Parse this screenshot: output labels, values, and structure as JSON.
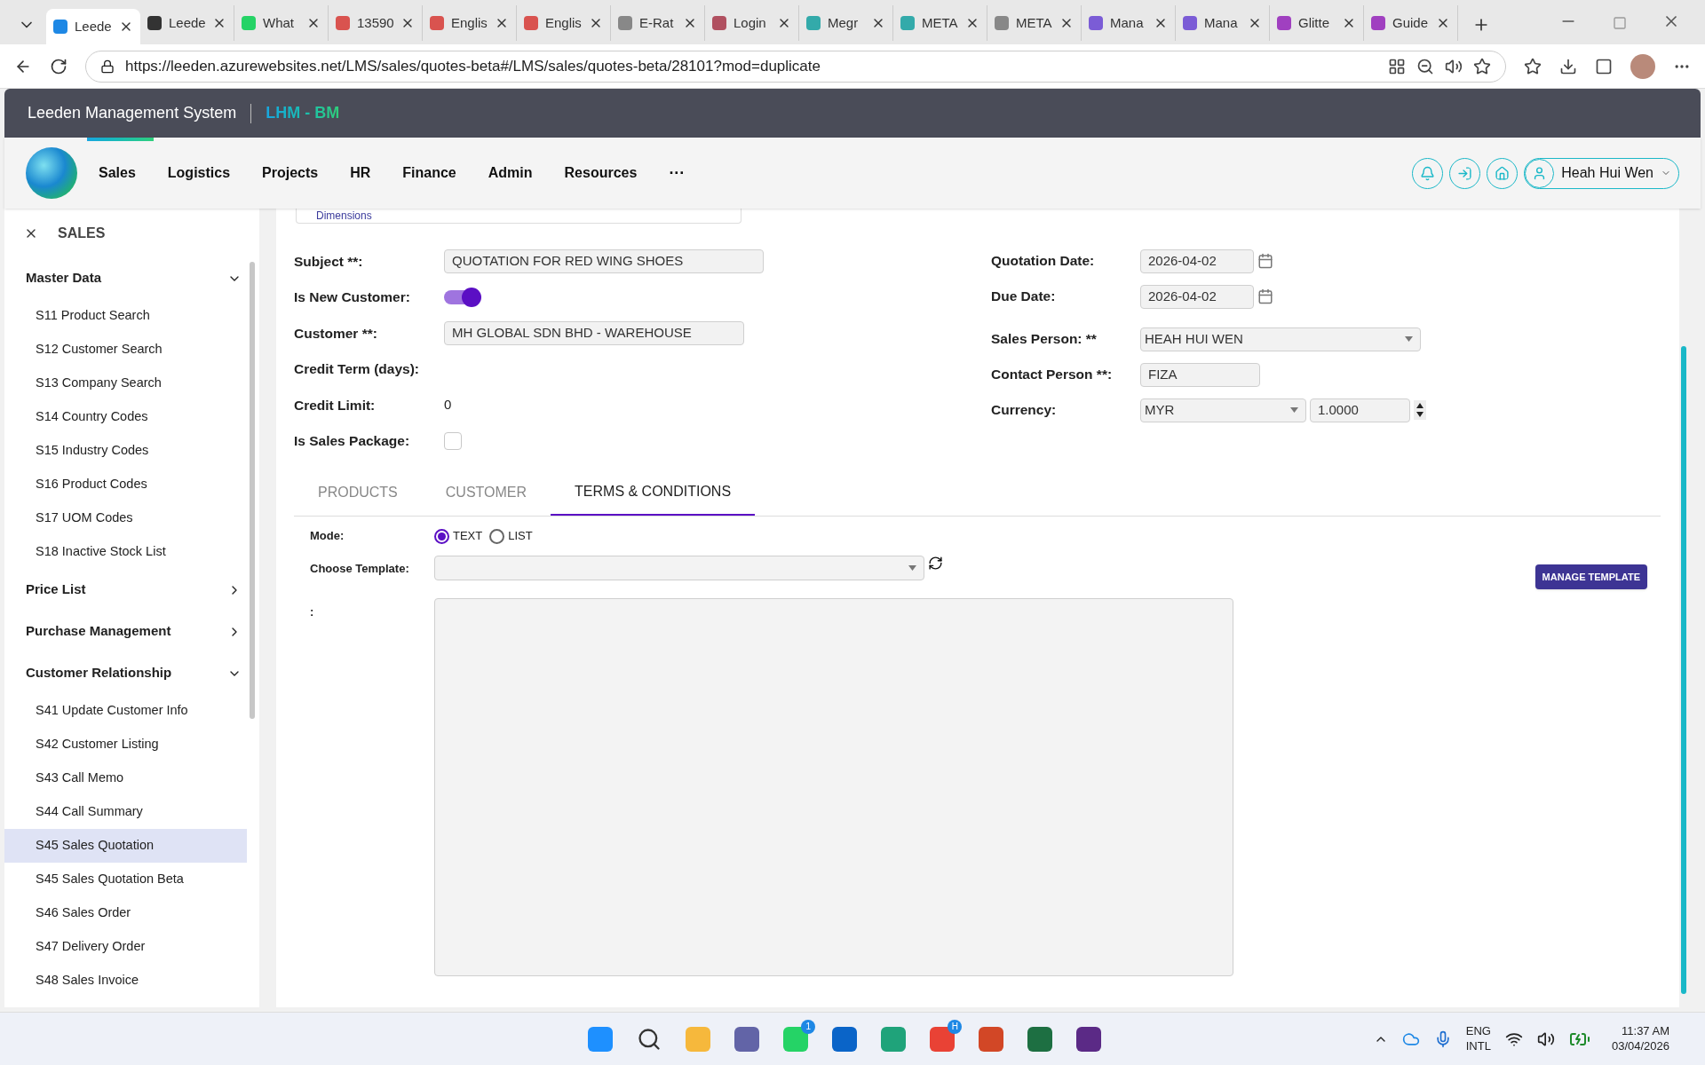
{
  "browser": {
    "tabs": [
      {
        "label": "Leede",
        "selected": true,
        "kind": "globe"
      },
      {
        "label": "Leede",
        "selected": false,
        "kind": "ie"
      },
      {
        "label": "What",
        "selected": false,
        "kind": "chat"
      },
      {
        "label": "13590",
        "selected": false,
        "kind": "pdf"
      },
      {
        "label": "Englis",
        "selected": false,
        "kind": "pdf"
      },
      {
        "label": "Englis",
        "selected": false,
        "kind": "pdf"
      },
      {
        "label": "E-Rat",
        "selected": false,
        "kind": "web"
      },
      {
        "label": "Login",
        "selected": false,
        "kind": "m"
      },
      {
        "label": "Megr",
        "selected": false,
        "kind": "sheet"
      },
      {
        "label": "META",
        "selected": false,
        "kind": "sheet"
      },
      {
        "label": "META",
        "selected": false,
        "kind": "web"
      },
      {
        "label": "Mana",
        "selected": false,
        "kind": "chevron"
      },
      {
        "label": "Mana",
        "selected": false,
        "kind": "chevron"
      },
      {
        "label": "Glitte",
        "selected": false,
        "kind": "g"
      },
      {
        "label": "Guide",
        "selected": false,
        "kind": "g"
      }
    ],
    "url": "https://leeden.azurewebsites.net/LMS/sales/quotes-beta#/LMS/sales/quotes-beta/28101?mod=duplicate"
  },
  "app": {
    "title": "Leeden Management System",
    "subtitle": "LHM - BM"
  },
  "nav": {
    "items": [
      "Sales",
      "Logistics",
      "Projects",
      "HR",
      "Finance",
      "Admin",
      "Resources"
    ],
    "more": "···",
    "user": "Heah Hui Wen"
  },
  "sidebar": {
    "title": "SALES",
    "groups": [
      {
        "label": "Master Data",
        "expanded": true,
        "children": [
          {
            "label": "S11 Product Search",
            "selected": false
          },
          {
            "label": "S12 Customer Search",
            "selected": false
          },
          {
            "label": "S13 Company Search",
            "selected": false
          },
          {
            "label": "S14 Country Codes",
            "selected": false
          },
          {
            "label": "S15 Industry Codes",
            "selected": false
          },
          {
            "label": "S16 Product Codes",
            "selected": false
          },
          {
            "label": "S17 UOM Codes",
            "selected": false
          },
          {
            "label": "S18 Inactive Stock List",
            "selected": false
          }
        ]
      },
      {
        "label": "Price List",
        "expanded": false
      },
      {
        "label": "Purchase Management",
        "expanded": false
      },
      {
        "label": "Customer Relationship",
        "expanded": true,
        "children": [
          {
            "label": "S41 Update Customer Info",
            "selected": false
          },
          {
            "label": "S42 Customer Listing",
            "selected": false
          },
          {
            "label": "S43 Call Memo",
            "selected": false
          },
          {
            "label": "S44 Call Summary",
            "selected": false
          },
          {
            "label": "S45 Sales Quotation",
            "selected": true
          },
          {
            "label": "S45 Sales Quotation Beta",
            "selected": false
          },
          {
            "label": "S46 Sales Order",
            "selected": false
          },
          {
            "label": "S47 Delivery Order",
            "selected": false
          },
          {
            "label": "S48 Sales Invoice",
            "selected": false
          }
        ]
      }
    ]
  },
  "form": {
    "section": "Dimensions",
    "left": [
      {
        "kind": "text",
        "label": "Subject **:",
        "value": "QUOTATION FOR RED WING SHOES"
      },
      {
        "kind": "toggle",
        "label": "Is New Customer:",
        "on": true
      },
      {
        "kind": "text",
        "label": "Customer **:",
        "value": "MH GLOBAL SDN BHD - WAREHOUSE"
      },
      {
        "kind": "plain",
        "label": "Credit Term (days):"
      },
      {
        "kind": "plain",
        "label": "Credit Limit:",
        "value": "0"
      },
      {
        "kind": "checkbox",
        "label": "Is Sales Package:",
        "checked": false
      }
    ],
    "right": [
      {
        "kind": "date",
        "label": "Quotation Date:",
        "value": "2026-04-02"
      },
      {
        "kind": "date",
        "label": "Due Date:",
        "value": "2026-04-02"
      },
      {
        "kind": "select",
        "label": "Sales Person: **",
        "value": "HEAH HUI WEN"
      },
      {
        "kind": "text",
        "label": "Contact Person **:",
        "value": "FIZA"
      },
      {
        "kind": "currency",
        "label": "Currency:",
        "value": "MYR",
        "rate": "1.0000"
      }
    ]
  },
  "tabs": [
    {
      "label": "PRODUCTS",
      "selected": false
    },
    {
      "label": "CUSTOMER",
      "selected": false
    },
    {
      "label": "TERMS & CONDITIONS",
      "selected": true
    }
  ],
  "terms": {
    "mode_label": "Mode:",
    "modes": [
      {
        "label": "TEXT",
        "selected": true
      },
      {
        "label": "LIST",
        "selected": false
      }
    ],
    "template_label": "Choose Template:",
    "manage_button": "MANAGE TEMPLATE",
    "text_label": ":"
  },
  "taskbar": {
    "apps": [
      {
        "kind": "start"
      },
      {
        "kind": "search"
      },
      {
        "kind": "folder"
      },
      {
        "kind": "teams"
      },
      {
        "kind": "whatsapp",
        "badge": "1"
      },
      {
        "kind": "outlook"
      },
      {
        "kind": "edge"
      },
      {
        "kind": "chrome",
        "badge": "H"
      },
      {
        "kind": "powerpoint"
      },
      {
        "kind": "excel"
      },
      {
        "kind": "app"
      }
    ],
    "lang": "ENG",
    "layout": "INTL",
    "time": "11:37 AM",
    "date": "03/04/2026"
  }
}
